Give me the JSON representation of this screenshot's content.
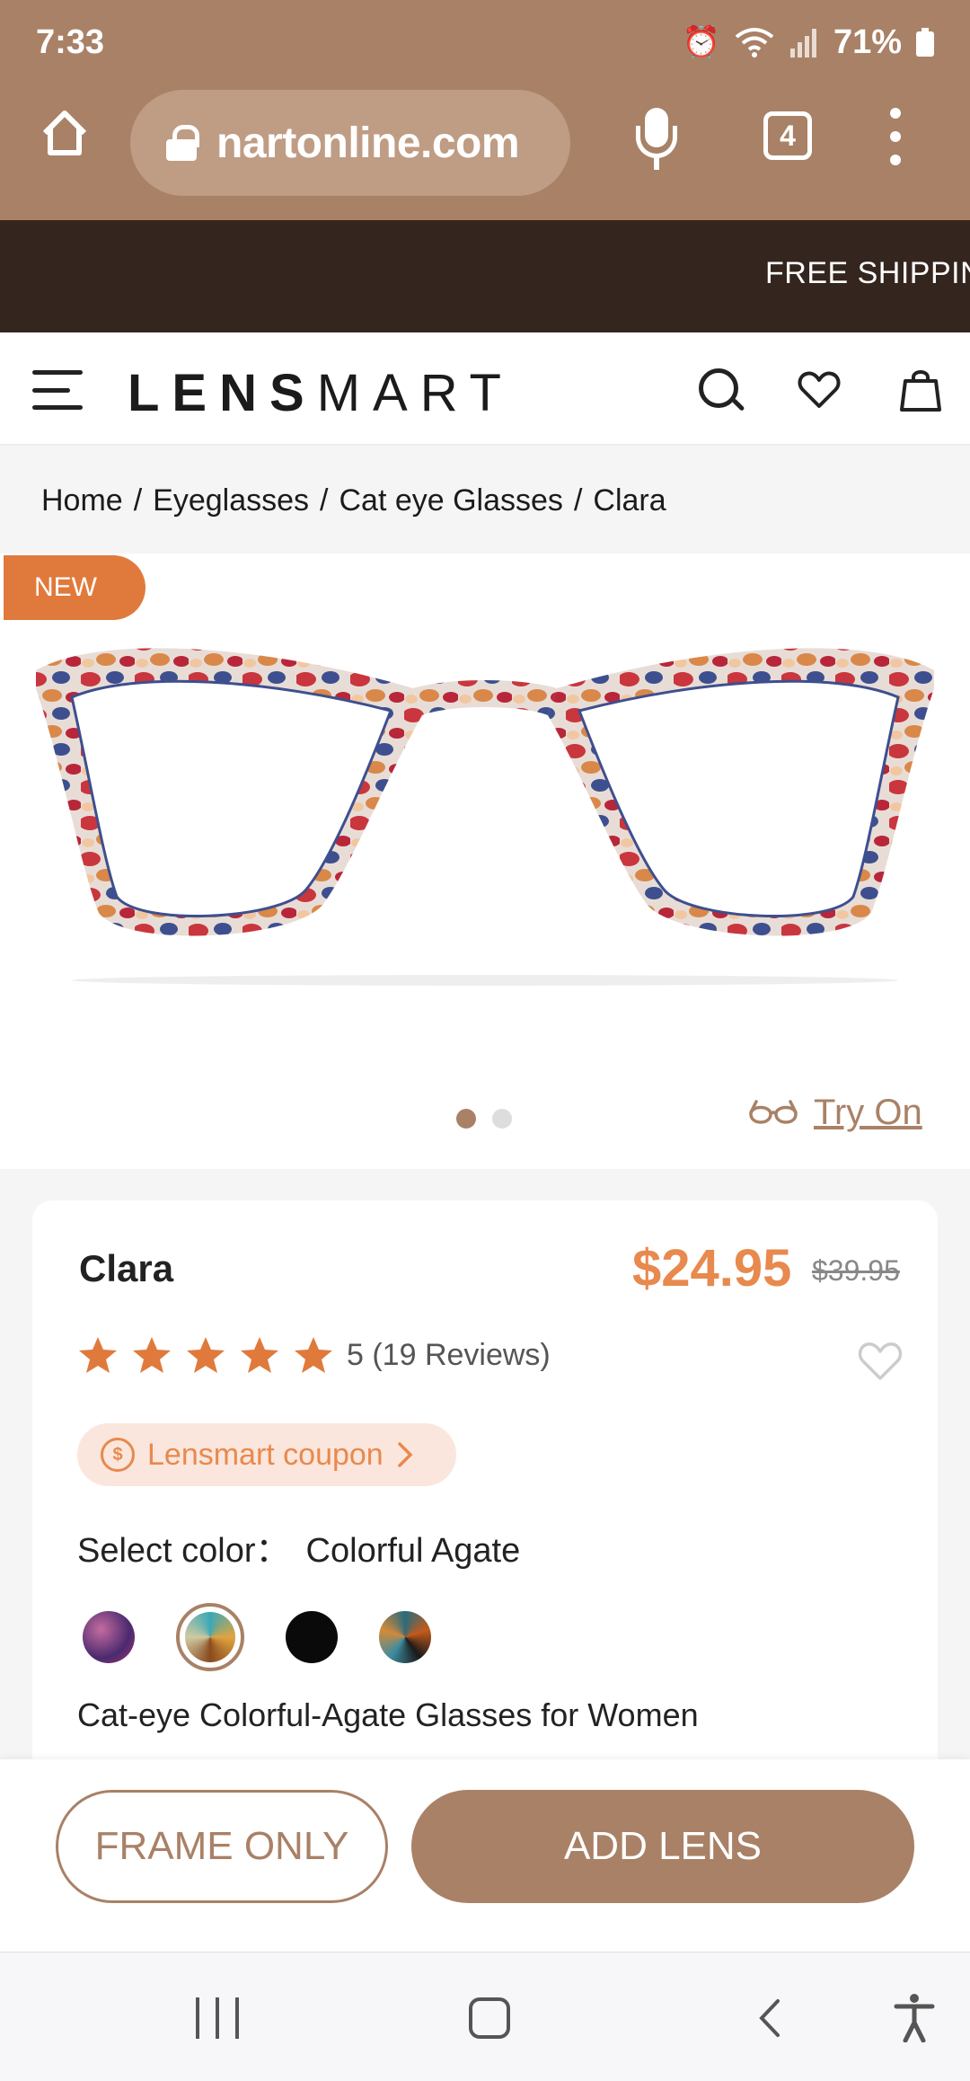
{
  "status_bar": {
    "time": "7:33",
    "battery": "71%",
    "icons": [
      "alarm-icon",
      "wifi-icon",
      "signal-icon",
      "battery-icon"
    ]
  },
  "browser": {
    "url": "nartonline.com",
    "tab_count": "4",
    "icons": [
      "home-icon",
      "lock-icon",
      "mic-icon",
      "tabs-icon",
      "more-vert-icon"
    ]
  },
  "promo_bar": {
    "text": "FREE SHIPPING"
  },
  "site_header": {
    "logo_bold": "LENS",
    "logo_rest": "MART",
    "icons": [
      "menu-icon",
      "search-icon",
      "heart-icon",
      "bag-icon"
    ]
  },
  "breadcrumb": {
    "items": [
      "Home",
      "Eyeglasses",
      "Cat eye Glasses",
      "Clara"
    ],
    "separator": "/"
  },
  "gallery": {
    "badge": "NEW",
    "image_count": 2,
    "active_index": 0,
    "try_on_label": "Try On"
  },
  "product": {
    "name": "Clara",
    "price": "$24.95",
    "original_price": "$39.95",
    "rating_value": 5,
    "rating_text": "5 (19 Reviews)",
    "coupon_label": "Lensmart coupon",
    "select_color_label": "Select color：",
    "selected_color": "Colorful Agate",
    "swatches": [
      "purple-pink",
      "colorful-agate",
      "black",
      "tortoise-teal"
    ],
    "selected_swatch_index": 1,
    "description": "Cat-eye Colorful-Agate Glasses for Women"
  },
  "actions": {
    "frame_only_label": "FRAME ONLY",
    "add_lens_label": "ADD LENS"
  },
  "colors": {
    "brand": "#a98166",
    "accent_orange": "#e8894e",
    "dark_bar": "#35251f"
  }
}
